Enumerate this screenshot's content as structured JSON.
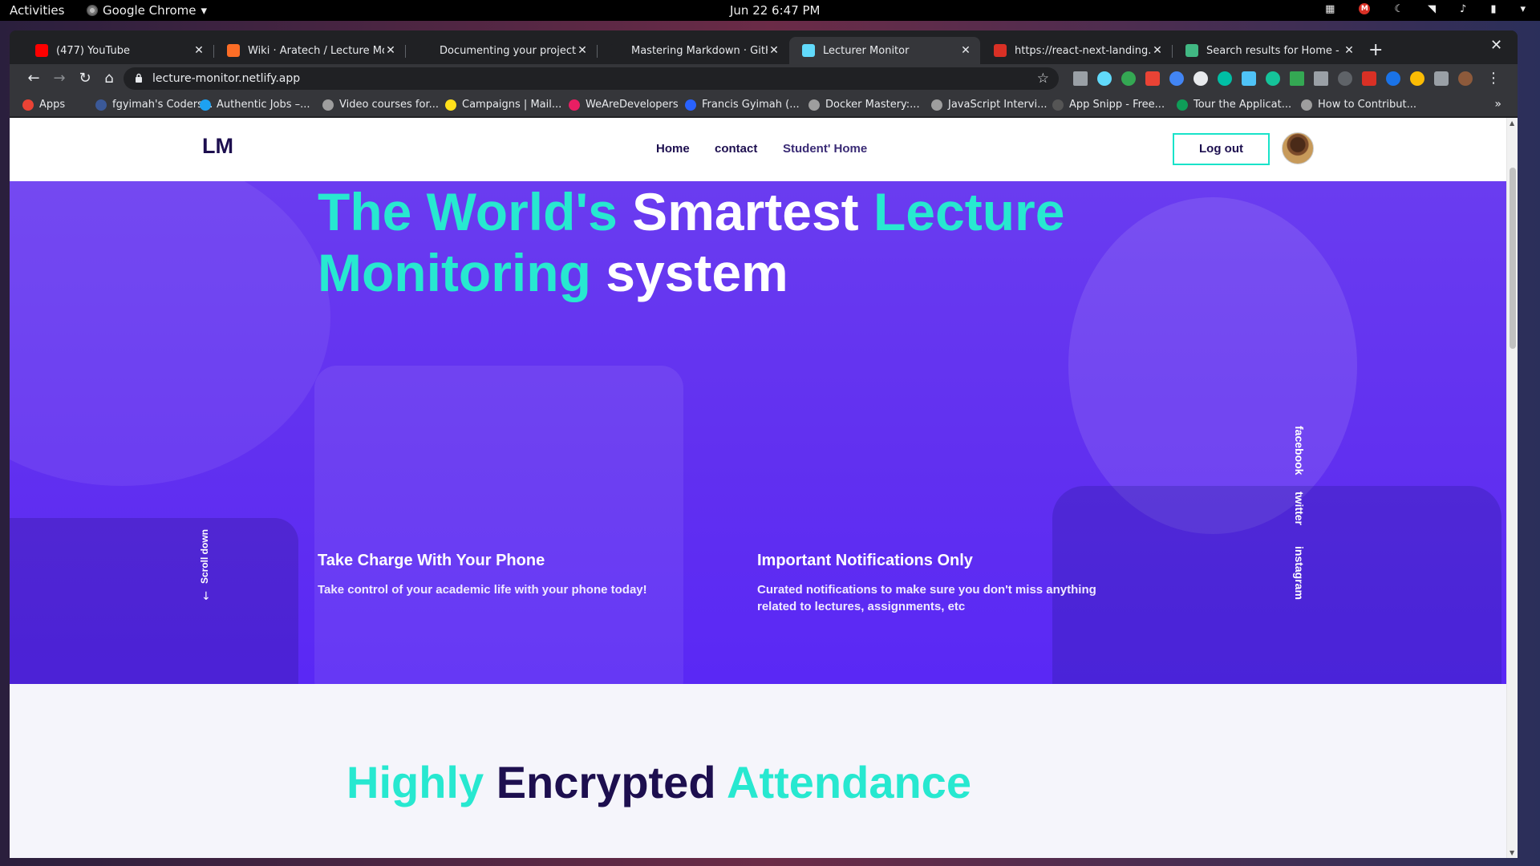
{
  "os": {
    "activities": "Activities",
    "app_name": "Google Chrome",
    "clock": "Jun 22  6:47 PM"
  },
  "browser": {
    "tabs": [
      {
        "title": "(477) YouTube",
        "icon": "youtube-icon",
        "color": "#ff0000",
        "active": false
      },
      {
        "title": "Wiki · Aratech / Lecture Monitoring",
        "icon": "gitlab-icon",
        "color": "#fc6d26",
        "active": false
      },
      {
        "title": "Documenting your projects on GitHub",
        "icon": "github-icon",
        "color": "#202124",
        "active": false
      },
      {
        "title": "Mastering Markdown · GitHub",
        "icon": "github-icon",
        "color": "#202124",
        "active": false
      },
      {
        "title": "Lecturer Monitor",
        "icon": "react-icon",
        "color": "#61dafb",
        "active": true
      },
      {
        "title": "https://react-next-landing.redq.io",
        "icon": "gmail-icon",
        "color": "#d93025",
        "active": false
      },
      {
        "title": "Search results for Home - Flatsome",
        "icon": "vue-icon",
        "color": "#41b883",
        "active": false
      }
    ],
    "url": "lecture-monitor.netlify.app",
    "bookmarks": [
      {
        "label": "Apps",
        "icon": "apps-grid-icon",
        "color": "#ea4335"
      },
      {
        "label": "fgyimah's Coders...",
        "icon": "bookmark-icon",
        "color": "#3b5998"
      },
      {
        "label": "Authentic Jobs –...",
        "icon": "globe-icon",
        "color": "#1da1f2"
      },
      {
        "label": "Video courses for...",
        "icon": "globe-icon",
        "color": "#9e9e9e"
      },
      {
        "label": "Campaigns | Mail...",
        "icon": "mailchimp-icon",
        "color": "#ffe01b"
      },
      {
        "label": "WeAreDevelopers",
        "icon": "wearedevelopers-icon",
        "color": "#e91e63"
      },
      {
        "label": "Francis Gyimah (...",
        "icon": "infinity-icon",
        "color": "#2962ff"
      },
      {
        "label": "Docker Mastery:...",
        "icon": "globe-icon",
        "color": "#9e9e9e"
      },
      {
        "label": "JavaScript Intervi...",
        "icon": "globe-icon",
        "color": "#9e9e9e"
      },
      {
        "label": "App Snipp - Free...",
        "icon": "code-icon",
        "color": "#555555"
      },
      {
        "label": "Tour the Applicat...",
        "icon": "shield-icon",
        "color": "#0f9d58"
      },
      {
        "label": "How to Contribut...",
        "icon": "globe-icon",
        "color": "#9e9e9e"
      }
    ]
  },
  "site": {
    "logo": "LM",
    "nav": {
      "home": "Home",
      "contact": "contact",
      "student_home": "Student' Home",
      "logout": "Log out"
    },
    "hero": {
      "title": {
        "p1": "The World's",
        "p2": "Smartest",
        "p3": "Lecture",
        "p4": "Monitoring",
        "p5": "system"
      },
      "features": [
        {
          "title": "Take Charge With Your Phone",
          "text": "Take control of your academic life with your phone today!"
        },
        {
          "title": "Important Notifications Only",
          "text": "Curated notifications to make sure you don't miss anything related to lectures, assignments, etc"
        }
      ],
      "scroll_down": "Scroll down",
      "social": {
        "facebook": "facebook",
        "twitter": "twitter",
        "instagram": "instagram"
      }
    },
    "section2": {
      "title": {
        "p1": "Highly",
        "p2": "Encrypted",
        "p3": "Attendance"
      }
    }
  },
  "colors": {
    "accent_cyan": "#27e8d0",
    "brand_dark": "#1d0f4f",
    "hero_purple": "#6130f0"
  }
}
